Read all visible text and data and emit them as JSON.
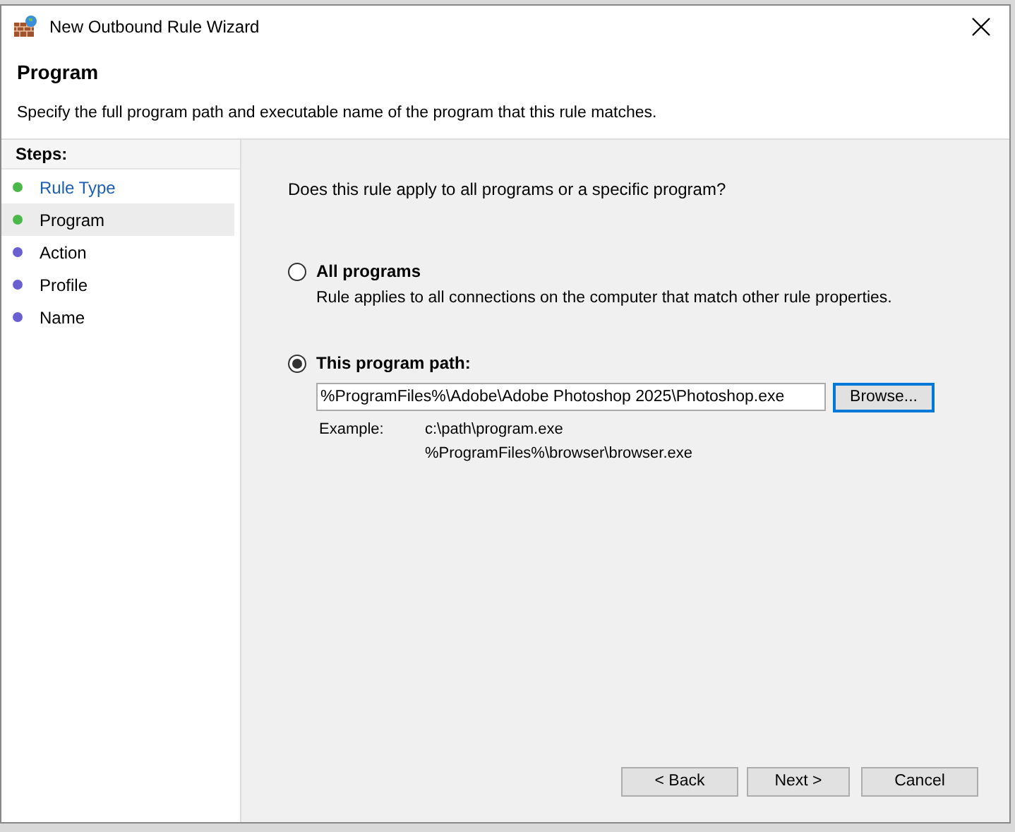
{
  "window": {
    "title": "New Outbound Rule Wizard"
  },
  "header": {
    "title": "Program",
    "subtitle": "Specify the full program path and executable name of the program that this rule matches."
  },
  "steps": {
    "heading": "Steps:",
    "items": [
      {
        "label": "Rule Type",
        "completed": true,
        "selected": false
      },
      {
        "label": "Program",
        "completed": true,
        "selected": true
      },
      {
        "label": "Action",
        "completed": false,
        "selected": false
      },
      {
        "label": "Profile",
        "completed": false,
        "selected": false
      },
      {
        "label": "Name",
        "completed": false,
        "selected": false
      }
    ]
  },
  "question": "Does this rule apply to all programs or a specific program?",
  "options": [
    {
      "label": "All programs",
      "description": "Rule applies to all connections on the computer that match other rule properties.",
      "selected": false
    },
    {
      "label": "This program path:",
      "selected": true
    }
  ],
  "path_field": {
    "value": "%ProgramFiles%\\Adobe\\Adobe Photoshop 2025\\Photoshop.exe"
  },
  "browse_button": "Browse...",
  "example": {
    "label": "Example:",
    "lines": [
      "c:\\path\\program.exe",
      "%ProgramFiles%\\browser\\browser.exe"
    ]
  },
  "buttons": [
    "< Back",
    "Next >",
    "Cancel"
  ]
}
